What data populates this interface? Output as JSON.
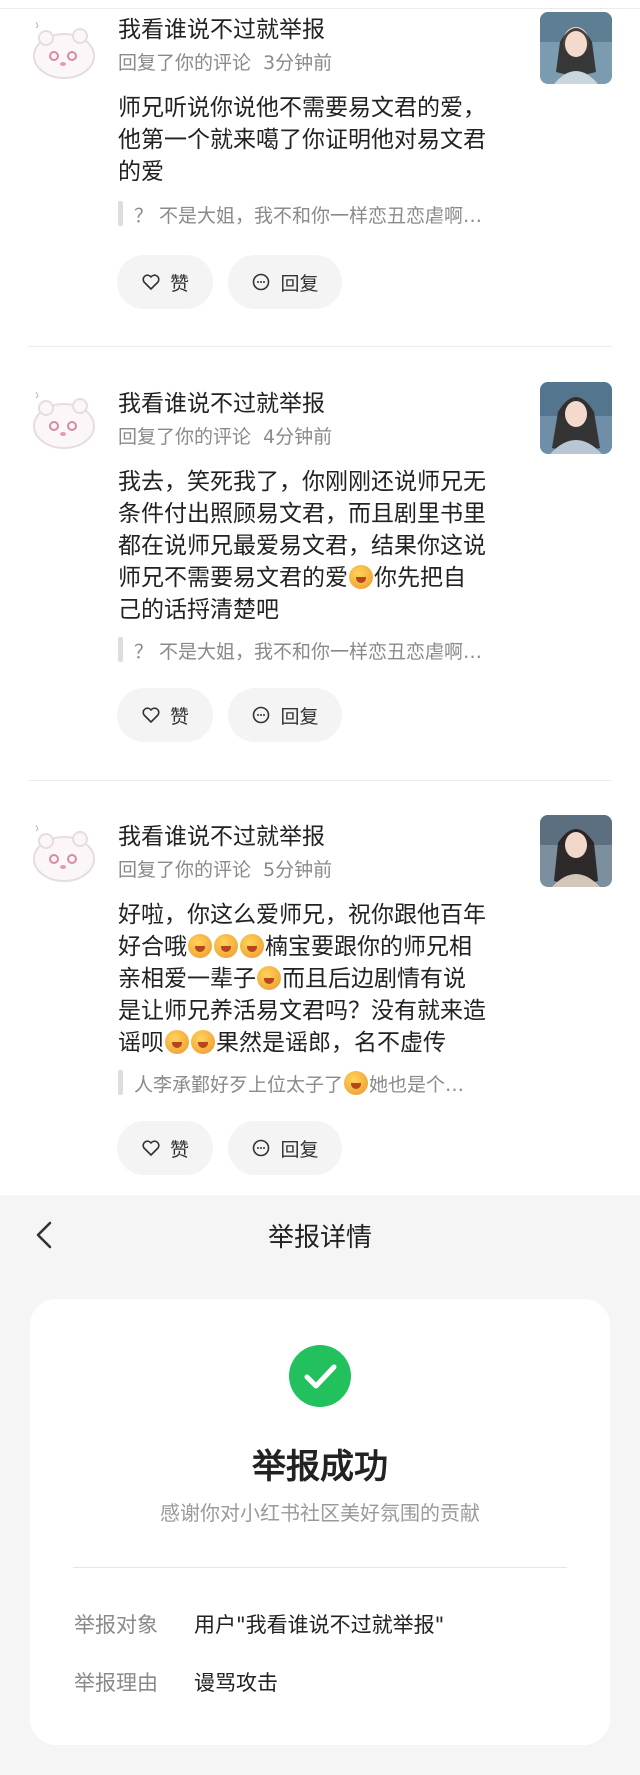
{
  "notifications": [
    {
      "user": "我看谁说不过就举报",
      "action": "回复了你的评论",
      "time": "3分钟前",
      "lines": [
        "师兄听说你说他不需要易文君的爱，",
        "他第一个就来噶了你证明他对易文君",
        "的爱"
      ],
      "quote": "？ 不是大姐，我不和你一样恋丑恋虐啊…",
      "like_label": "赞",
      "reply_label": "回复"
    },
    {
      "user": "我看谁说不过就举报",
      "action": "回复了你的评论",
      "time": "4分钟前",
      "lines": [
        "我去，笑死我了，你刚刚还说师兄无",
        "条件付出照顾易文君，而且剧里书里",
        "都在说师兄最爱易文君，结果你这说",
        "师兄不需要易文君的爱[emoji]你先把自",
        "己的话捋清楚吧"
      ],
      "quote": "？ 不是大姐，我不和你一样恋丑恋虐啊…",
      "like_label": "赞",
      "reply_label": "回复"
    },
    {
      "user": "我看谁说不过就举报",
      "action": "回复了你的评论",
      "time": "5分钟前",
      "lines": [
        "好啦，你这么爱师兄，祝你跟他百年",
        "好合哦[emoji][emoji][emoji]楠宝要跟你的师兄相",
        "亲相爱一辈子[emoji]而且后边剧情有说",
        "是让师兄养活易文君吗？没有就来造",
        "谣呗[emoji][emoji]果然是谣郎，名不虚传"
      ],
      "quote": "人李承鄞好歹上位太子了[emoji]她也是个…",
      "like_label": "赞",
      "reply_label": "回复"
    }
  ],
  "report": {
    "title": "举报详情",
    "status_title": "举报成功",
    "thanks": "感谢你对小红书社区美好氛围的贡献",
    "rows": [
      {
        "label": "举报对象",
        "value": "用户\"我看谁说不过就举报\""
      },
      {
        "label": "举报理由",
        "value": "谩骂攻击"
      }
    ]
  },
  "colors": {
    "success_green": "#22c15e",
    "panel_bg": "#f5f5f5",
    "pill_bg": "#f4f4f4"
  },
  "icons": {
    "like": "heart-outline-icon",
    "reply": "chat-bubble-icon",
    "back": "chevron-left-icon",
    "success": "check-circle-icon"
  }
}
